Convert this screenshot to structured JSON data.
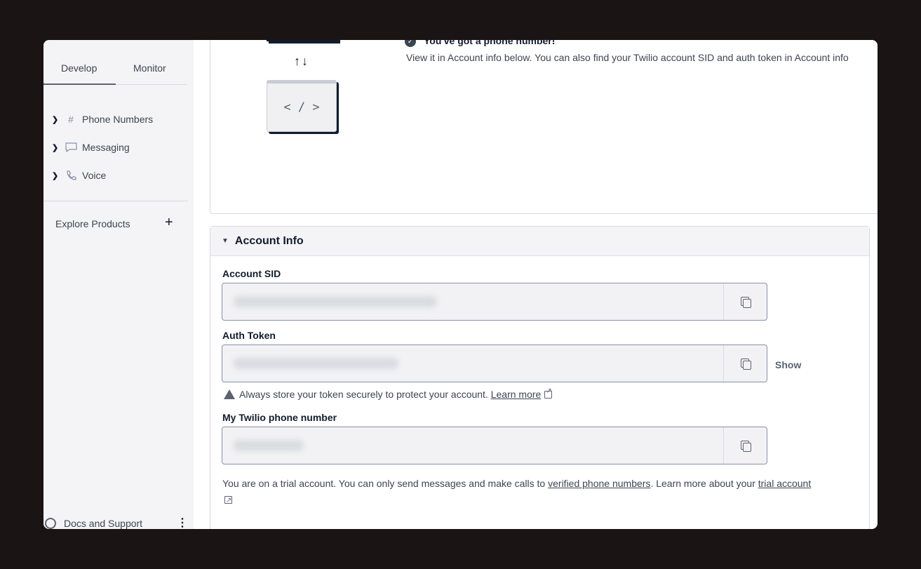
{
  "sidebar": {
    "tabs": [
      {
        "label": "Develop",
        "active": true
      },
      {
        "label": "Monitor",
        "active": false
      }
    ],
    "items": [
      {
        "label": "Phone Numbers",
        "icon": "hash-icon"
      },
      {
        "label": "Messaging",
        "icon": "chat-bubble-icon"
      },
      {
        "label": "Voice",
        "icon": "phone-icon"
      }
    ],
    "explore": "Explore Products",
    "docs": "Docs and Support"
  },
  "top_card": {
    "success_title": "You've got a phone number!",
    "success_body": "View it in Account info below. You can also find your Twilio account SID and auth token in Account info",
    "arrows": "↑↓",
    "code_glyph": "< / >"
  },
  "account_info": {
    "title": "Account Info",
    "fields": [
      {
        "label": "Account SID",
        "value": ""
      },
      {
        "label": "Auth Token",
        "value": ""
      },
      {
        "label": "My Twilio phone number",
        "value": ""
      }
    ],
    "show_label": "Show",
    "warning_text": "Always store your token securely to protect your account.",
    "warning_link": "Learn more",
    "trial_text_1": "You are on a trial account. You can only send messages and make calls to",
    "trial_link_1": "verified phone numbers",
    "trial_text_2": ". Learn more about your",
    "trial_link_2": "trial account"
  }
}
